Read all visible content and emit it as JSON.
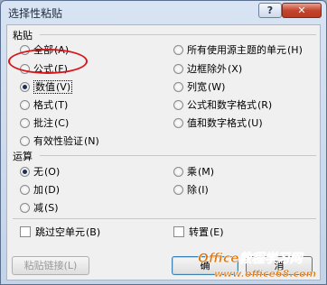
{
  "window": {
    "title": "选择性粘贴",
    "help": "?",
    "close": "✕"
  },
  "paste": {
    "header": "粘贴",
    "left": [
      {
        "label": "全部",
        "key": "(A)",
        "selected": false
      },
      {
        "label": "公式",
        "key": "(F)",
        "selected": false
      },
      {
        "label": "数值",
        "key": "(V)",
        "selected": true
      },
      {
        "label": "格式",
        "key": "(T)",
        "selected": false
      },
      {
        "label": "批注",
        "key": "(C)",
        "selected": false
      },
      {
        "label": "有效性验证",
        "key": "(N)",
        "selected": false
      }
    ],
    "right": [
      {
        "label": "所有使用源主题的单元",
        "key": "(H)",
        "selected": false
      },
      {
        "label": "边框除外",
        "key": "(X)",
        "selected": false
      },
      {
        "label": "列宽",
        "key": "(W)",
        "selected": false
      },
      {
        "label": "公式和数字格式",
        "key": "(R)",
        "selected": false
      },
      {
        "label": "值和数字格式",
        "key": "(U)",
        "selected": false
      }
    ]
  },
  "operation": {
    "header": "运算",
    "left": [
      {
        "label": "无",
        "key": "(O)",
        "selected": true
      },
      {
        "label": "加",
        "key": "(D)",
        "selected": false
      },
      {
        "label": "减",
        "key": "(S)",
        "selected": false
      }
    ],
    "right": [
      {
        "label": "乘",
        "key": "(M)",
        "selected": false
      },
      {
        "label": "除",
        "key": "(I)",
        "selected": false
      }
    ]
  },
  "checks": {
    "skip_blanks": {
      "label": "跳过空单元",
      "key": "(B)",
      "checked": false
    },
    "transpose": {
      "label": "转置",
      "key": "(E)",
      "checked": false
    }
  },
  "buttons": {
    "paste_link": "粘贴链接(L)",
    "ok": "确",
    "cancel": "消"
  },
  "watermark": {
    "brand": "Office教程学习网",
    "url": "www.office68.com"
  },
  "colors": {
    "highlight": "#d8171b",
    "watermark_orange": "#e07a10"
  }
}
